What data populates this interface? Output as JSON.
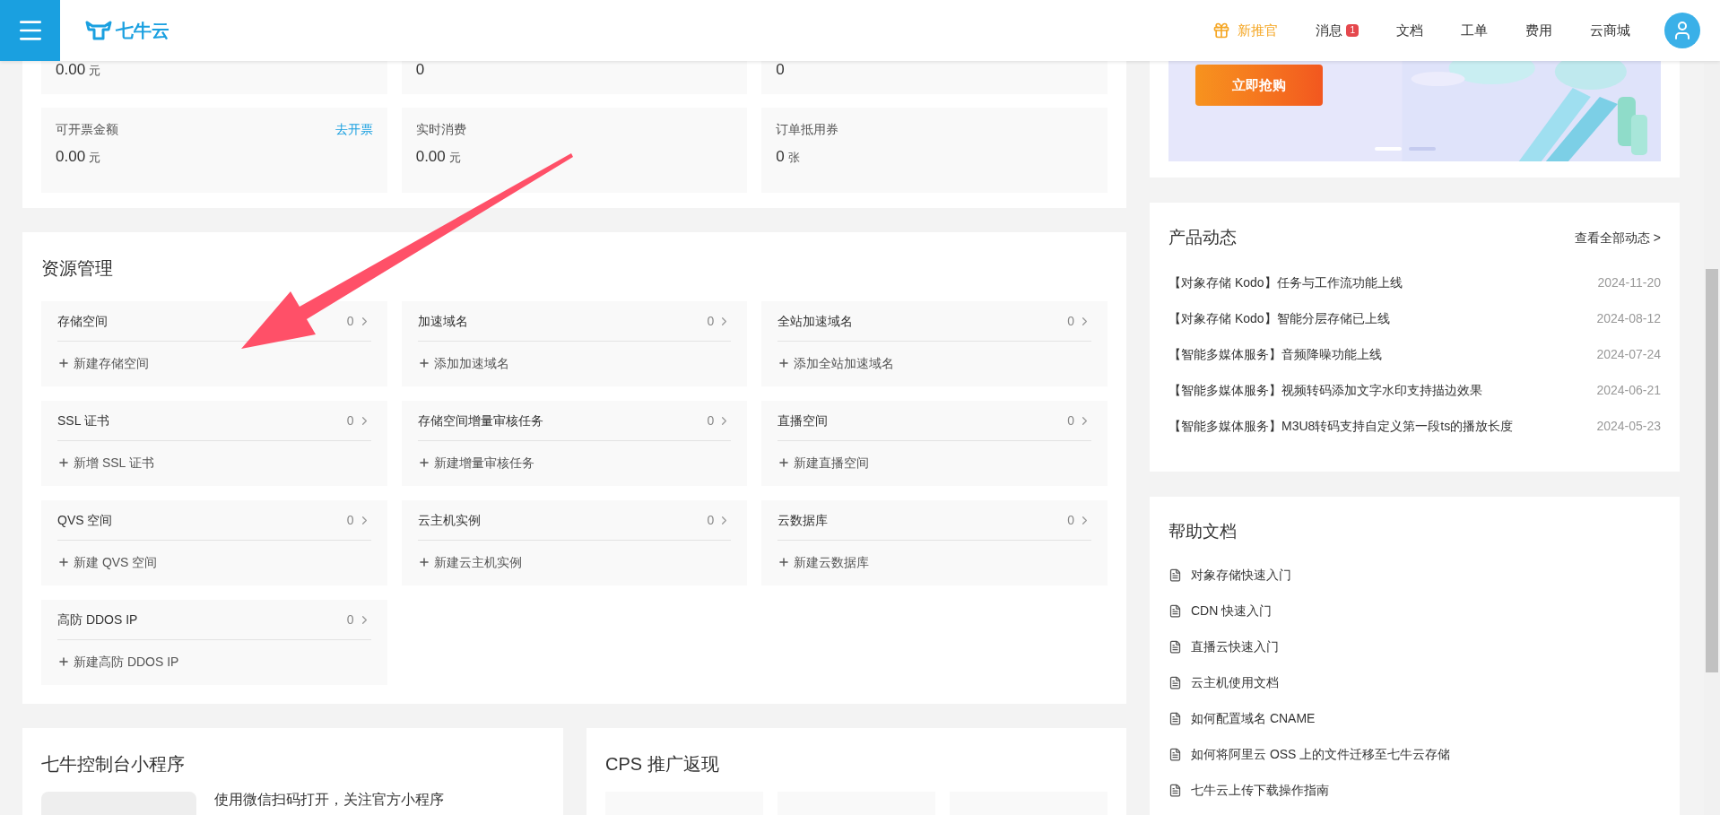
{
  "header": {
    "logo_text": "七牛云",
    "nav": [
      {
        "label": "新推官",
        "kind": "promo"
      },
      {
        "label": "消息",
        "kind": "badge",
        "badge": "1"
      },
      {
        "label": "文档",
        "kind": "plain"
      },
      {
        "label": "工单",
        "kind": "plain"
      },
      {
        "label": "费用",
        "kind": "plain"
      },
      {
        "label": "云商城",
        "kind": "plain"
      }
    ]
  },
  "account_summary": {
    "rows": [
      [
        {
          "value": "0.00",
          "unit": "元"
        },
        {
          "value": "0"
        },
        {
          "value": "0"
        }
      ],
      [
        {
          "label": "可开票金额",
          "value": "0.00",
          "unit": "元",
          "link": "去开票"
        },
        {
          "label": "实时消费",
          "value": "0.00",
          "unit": "元"
        },
        {
          "label": "订单抵用券",
          "value": "0",
          "unit": "张"
        }
      ]
    ]
  },
  "resources": {
    "title": "资源管理",
    "items": [
      {
        "name": "存储空间",
        "count": "0",
        "action": "新建存储空间"
      },
      {
        "name": "加速域名",
        "count": "0",
        "action": "添加加速域名"
      },
      {
        "name": "全站加速域名",
        "count": "0",
        "action": "添加全站加速域名"
      },
      {
        "name": "SSL 证书",
        "count": "0",
        "action": "新增 SSL 证书"
      },
      {
        "name": "存储空间增量审核任务",
        "count": "0",
        "action": "新建增量审核任务"
      },
      {
        "name": "直播空间",
        "count": "0",
        "action": "新建直播空间"
      },
      {
        "name": "QVS 空间",
        "count": "0",
        "action": "新建 QVS 空间"
      },
      {
        "name": "云主机实例",
        "count": "0",
        "action": "新建云主机实例"
      },
      {
        "name": "云数据库",
        "count": "0",
        "action": "新建云数据库"
      },
      {
        "name": "高防 DDOS IP",
        "count": "0",
        "action": "新建高防 DDOS IP"
      }
    ]
  },
  "miniprogram": {
    "title": "七牛控制台小程序",
    "text": "使用微信扫码打开，关注官方小程序"
  },
  "cps": {
    "title": "CPS 推广返现"
  },
  "banner": {
    "button": "立即抢购",
    "dots": [
      {
        "selected": true
      },
      {
        "selected": false
      }
    ]
  },
  "news": {
    "title": "产品动态",
    "link": "查看全部动态 >",
    "items": [
      {
        "text": "【对象存储 Kodo】任务与工作流功能上线",
        "date": "2024-11-20"
      },
      {
        "text": "【对象存储 Kodo】智能分层存储已上线",
        "date": "2024-08-12"
      },
      {
        "text": "【智能多媒体服务】音频降噪功能上线",
        "date": "2024-07-24"
      },
      {
        "text": "【智能多媒体服务】视频转码添加文字水印支持描边效果",
        "date": "2024-06-21"
      },
      {
        "text": "【智能多媒体服务】M3U8转码支持自定义第一段ts的播放长度",
        "date": "2024-05-23"
      }
    ]
  },
  "help": {
    "title": "帮助文档",
    "items": [
      "对象存储快速入门",
      "CDN 快速入门",
      "直播云快速入门",
      "云主机使用文档",
      "如何配置域名 CNAME",
      "如何将阿里云 OSS 上的文件迁移至七牛云存储",
      "七牛云上传下载操作指南"
    ]
  }
}
